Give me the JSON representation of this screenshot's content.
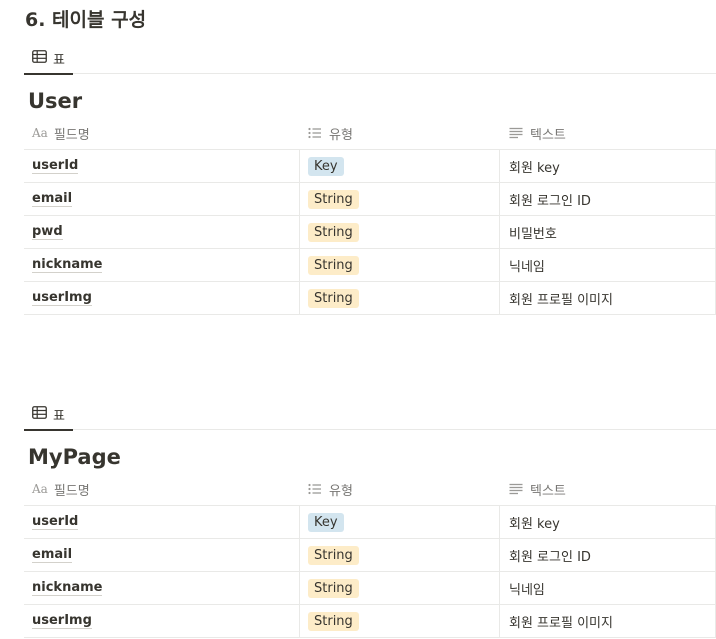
{
  "page": {
    "heading": "6. 테이블 구성"
  },
  "colors": {
    "key_tag": "#d3e5ef",
    "string_tag": "#fdecc8",
    "text": "#37352f",
    "muted": "#787774"
  },
  "databases": [
    {
      "view_tab": {
        "icon": "table-icon",
        "label": "표"
      },
      "title": "User",
      "columns": [
        {
          "icon": "title-aa-icon",
          "icon_text": "Aa",
          "label": "필드명"
        },
        {
          "icon": "list-icon",
          "label": "유형"
        },
        {
          "icon": "text-lines-icon",
          "label": "텍스트"
        }
      ],
      "rows": [
        {
          "name": "userId",
          "type": "Key",
          "text": "회원 key"
        },
        {
          "name": "email",
          "type": "String",
          "text": "회원 로그인 ID"
        },
        {
          "name": "pwd",
          "type": "String",
          "text": "비밀번호"
        },
        {
          "name": "nickname",
          "type": "String",
          "text": "닉네임"
        },
        {
          "name": "userImg",
          "type": "String",
          "text": "회원 프로필 이미지"
        }
      ]
    },
    {
      "view_tab": {
        "icon": "table-icon",
        "label": "표"
      },
      "title": "MyPage",
      "columns": [
        {
          "icon": "title-aa-icon",
          "icon_text": "Aa",
          "label": "필드명"
        },
        {
          "icon": "list-icon",
          "label": "유형"
        },
        {
          "icon": "text-lines-icon",
          "label": "텍스트"
        }
      ],
      "rows": [
        {
          "name": "userId",
          "type": "Key",
          "text": "회원 key"
        },
        {
          "name": "email",
          "type": "String",
          "text": "회원 로그인 ID"
        },
        {
          "name": "nickname",
          "type": "String",
          "text": "닉네임"
        },
        {
          "name": "userImg",
          "type": "String",
          "text": "회원 프로필 이미지"
        }
      ]
    }
  ]
}
